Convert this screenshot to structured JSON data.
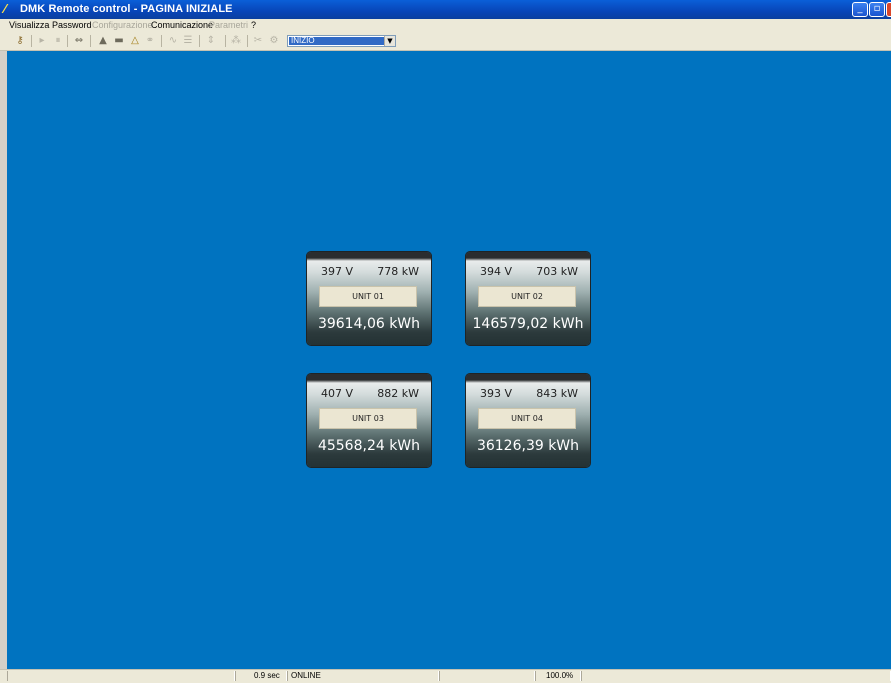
{
  "window": {
    "title": "DMK Remote control - PAGINA INIZIALE",
    "min_label": "_",
    "max_label": "▫",
    "close_label": ""
  },
  "menu": {
    "items": [
      {
        "label": "Visualizza",
        "enabled": true
      },
      {
        "label": "Password",
        "enabled": true
      },
      {
        "label": "Configurazione",
        "enabled": false
      },
      {
        "label": "Comunicazione",
        "enabled": true
      },
      {
        "label": "Parametri",
        "enabled": false
      },
      {
        "label": "?",
        "enabled": true
      }
    ]
  },
  "toolbar": {
    "page_select": {
      "value": "INIZIO"
    }
  },
  "units": [
    {
      "voltage": "397 V",
      "power": "778 kW",
      "name": "UNIT 01",
      "energy": "39614,06 kWh"
    },
    {
      "voltage": "394 V",
      "power": "703 kW",
      "name": "UNIT 02",
      "energy": "146579,02 kWh"
    },
    {
      "voltage": "407 V",
      "power": "882 kW",
      "name": "UNIT 03",
      "energy": "45568,24 kWh"
    },
    {
      "voltage": "393 V",
      "power": "843 kW",
      "name": "UNIT 04",
      "energy": "36126,39 kWh"
    }
  ],
  "status": {
    "cycle_time": "0.9 sec",
    "connection": "ONLINE",
    "zoom": "100.0%"
  },
  "colors": {
    "background": "#0073c0",
    "title_bar": "#0845b8"
  }
}
